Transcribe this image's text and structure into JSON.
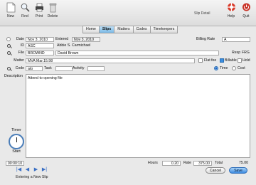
{
  "toolbar": {
    "new_label": "New",
    "find_label": "Find",
    "print_label": "Print",
    "delete_label": "Delete",
    "help_label": "Help",
    "quit_label": "Quit",
    "header_title": "Slip Detail"
  },
  "tabs": [
    {
      "label": "Home",
      "active": false
    },
    {
      "label": "Slips",
      "active": true
    },
    {
      "label": "Matters",
      "active": false
    },
    {
      "label": "Codes",
      "active": false
    },
    {
      "label": "Timekeepers",
      "active": false
    }
  ],
  "form": {
    "date_label": "Date",
    "date_value": "Nov 3, 2010",
    "entered_label": "Entered",
    "entered_value": "Nov 3, 2010",
    "billing_rate_label": "Billing Rate",
    "billing_rate_value": "A",
    "id_label": "ID",
    "id_value": "ASC",
    "id_name": "Abbie S. Carmichael",
    "file_label": "File",
    "file_value": "BROWND",
    "file_name": "David Brown",
    "resp_label": "Resp",
    "resp_value": "FRG",
    "matter_label": "Matter",
    "matter_value": "MVA Mar.15.98",
    "flat_fee_label": "Flat fee",
    "billable_label": "Billable",
    "hold_label": "Hold",
    "code_label": "Code",
    "code_value": "ato",
    "task_label": "Task",
    "task_value": "",
    "activity_label": "Activity",
    "activity_value": "",
    "time_label": "Time",
    "cost_label": "Cost",
    "description_label": "Description",
    "description_value": "Attend to opening file",
    "timer_label": "Timer",
    "start_label": "Start",
    "timer_value": "00:00:10"
  },
  "totals": {
    "hours_label": "Hours",
    "hours_value": "0.20",
    "rate_label": "Rate",
    "rate_value": "375.00",
    "total_label": "Total",
    "total_value": "75.00"
  },
  "buttons": {
    "cancel_label": "Cancel",
    "save_label": "Save"
  },
  "status_text": "Entering a New Slip"
}
